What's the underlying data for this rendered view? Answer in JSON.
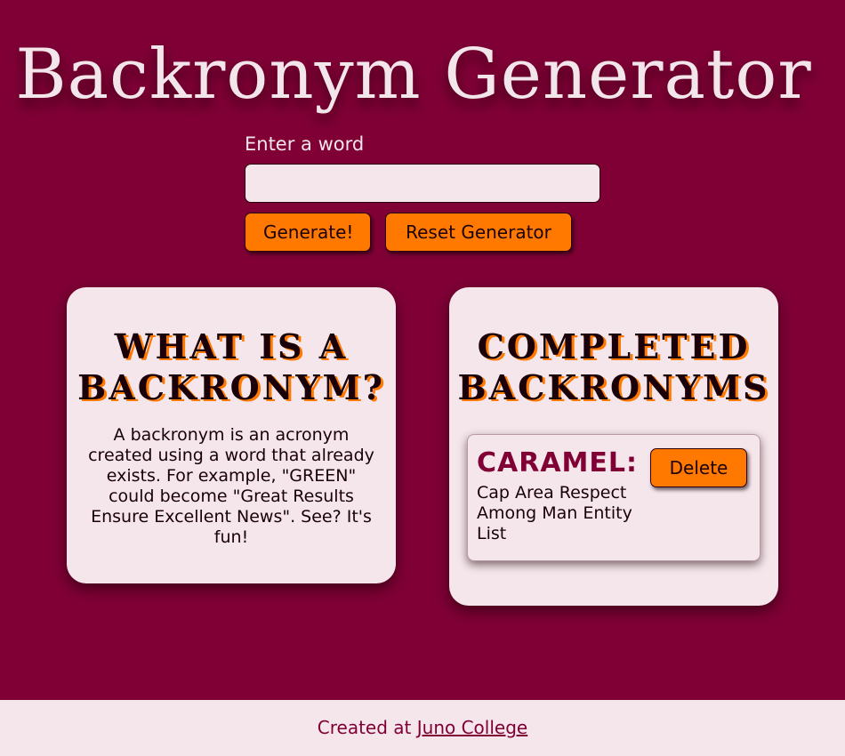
{
  "header": {
    "title": "Backronym Generator"
  },
  "form": {
    "input_label": "Enter a word",
    "input_value": "",
    "generate_label": "Generate!",
    "reset_label": "Reset Generator"
  },
  "info_card": {
    "heading": "WHAT IS A BACKRONYM?",
    "text": "A backronym is an acronym created using a word that already exists. For example, \"GREEN\" could become \"Great Results Ensure Excellent News\". See? It's fun!"
  },
  "completed_card": {
    "heading": "COMPLETED BACKRONYMS",
    "items": [
      {
        "word": "CARAMEL:",
        "phrase": "Cap Area Respect Among Man Entity List",
        "delete_label": "Delete"
      }
    ]
  },
  "footer": {
    "prefix": "Created at ",
    "link_text": "Juno College"
  },
  "colors": {
    "background": "#800036",
    "card": "#f4e6ea",
    "accent": "#ff7800"
  }
}
